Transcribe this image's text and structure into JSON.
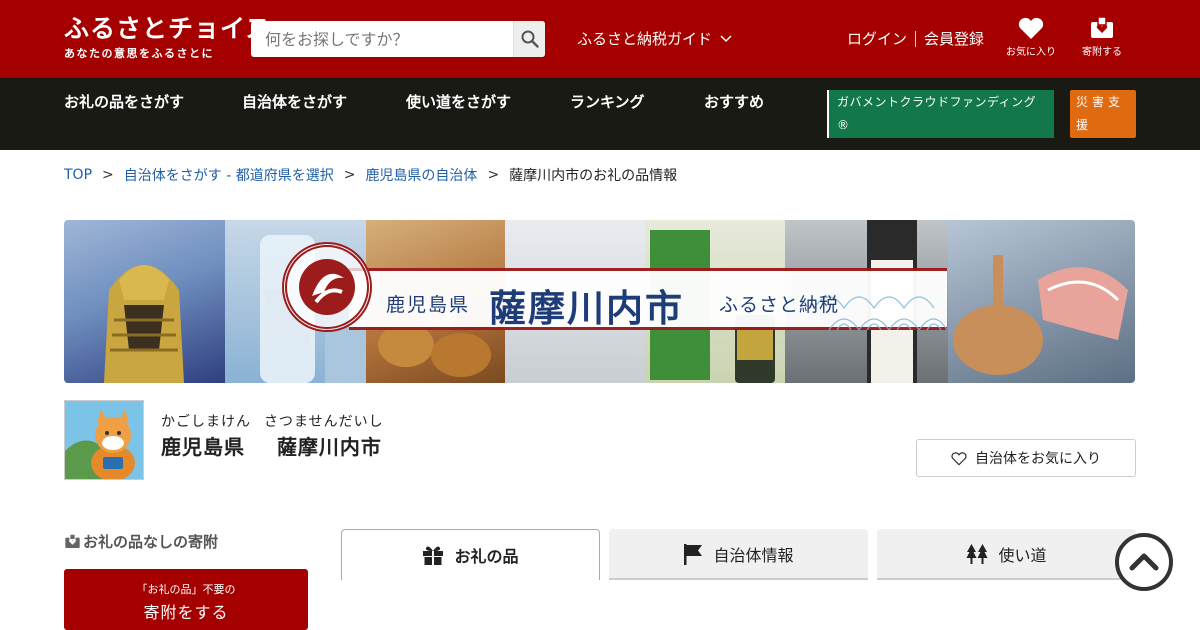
{
  "header": {
    "logo": "ふるさとチョイス",
    "logo_tagline": "あなたの意思をふるさとに",
    "search_placeholder": "何をお探しですか？",
    "guide": "ふるさと納税ガイド",
    "login": "ログイン",
    "register": "会員登録",
    "favorites": "お気に入り",
    "donations": "寄附する"
  },
  "nav": {
    "items": [
      "お礼の品をさがす",
      "自治体をさがす",
      "使い道をさがす",
      "ランキング",
      "おすすめ"
    ],
    "gov_crowdfunding": "ガバメントクラウドファンディング®",
    "disaster_support": "災害支援"
  },
  "breadcrumb": {
    "top": "TOP",
    "search_pref": "自治体をさがす - 都道府県を選択",
    "pref_munis": "鹿児島県の自治体",
    "current": "薩摩川内市のお礼の品情報"
  },
  "banner": {
    "prefecture": "鹿児島県",
    "city": "薩摩川内市",
    "tagline": "ふるさと納税"
  },
  "municipality": {
    "pref_reading": "かごしまけん",
    "city_reading": "さつませんだいし",
    "pref": "鹿児島県",
    "city": "薩摩川内市",
    "favorite_button": "自治体をお気に入り"
  },
  "sidebar": {
    "no_gift_heading": "お礼の品なしの寄附",
    "donate_sub": "「お礼の品」不要の",
    "donate_main": "寄附をする"
  },
  "tabs": {
    "gifts": "お礼の品",
    "muni_info": "自治体情報",
    "usage": "使い道"
  },
  "colors": {
    "brand_red": "#a50000",
    "nav_dark": "#1a1a14",
    "gov_green": "#12784a",
    "disaster_orange": "#e06a10",
    "link_blue": "#1f5fa8"
  }
}
